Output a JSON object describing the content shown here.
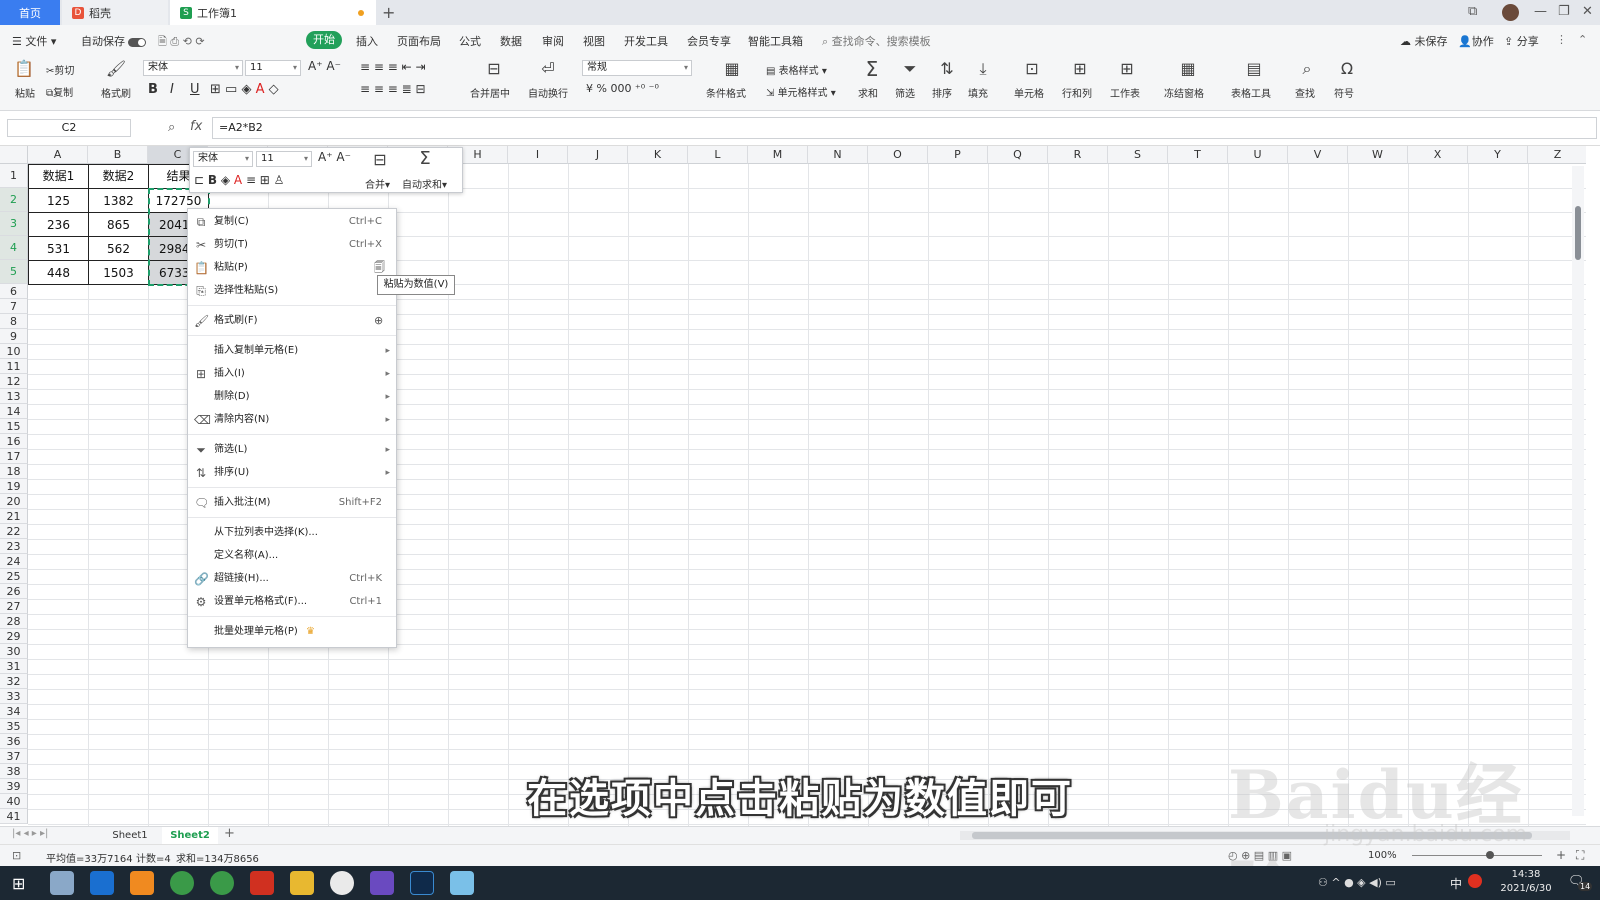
{
  "tabs": {
    "home": "首页",
    "daoke": "稻壳",
    "workbook": "工作簿1"
  },
  "menubar": {
    "file": "文件",
    "autosave": "自动保存",
    "items": [
      "开始",
      "插入",
      "页面布局",
      "公式",
      "数据",
      "审阅",
      "视图",
      "开发工具",
      "会员专享",
      "智能工具箱"
    ],
    "search": "查找命令、搜索模板",
    "unsaved": "未保存",
    "collab": "协作",
    "share": "分享"
  },
  "ribbon": {
    "paste": "粘贴",
    "cut": "剪切",
    "copy": "复制",
    "format_painter": "格式刷",
    "font_name": "宋体",
    "font_size": "11",
    "merge_center": "合并居中",
    "wrap": "自动换行",
    "number_format": "常规",
    "cond_format": "条件格式",
    "table_style": "表格样式",
    "cell_style": "单元格样式",
    "sum": "求和",
    "filter": "筛选",
    "sort": "排序",
    "fill": "填充",
    "cell": "单元格",
    "row_col": "行和列",
    "worksheet": "工作表",
    "freeze": "冻结窗格",
    "table_tools": "表格工具",
    "find": "查找",
    "symbol": "符号"
  },
  "formula_bar": {
    "name_box": "C2",
    "fx": "fx",
    "formula": "=A2*B2"
  },
  "columns": [
    "A",
    "B",
    "C",
    "D",
    "E",
    "F",
    "G",
    "H",
    "I",
    "J",
    "K",
    "L",
    "M",
    "N",
    "O",
    "P",
    "Q",
    "R",
    "S",
    "T",
    "U",
    "V",
    "W",
    "X",
    "Y",
    "Z"
  ],
  "rows": [
    "1",
    "2",
    "3",
    "4",
    "5",
    "6",
    "7",
    "8",
    "9",
    "10",
    "11",
    "12",
    "13",
    "14",
    "15",
    "16",
    "17",
    "18",
    "19",
    "20",
    "21",
    "22",
    "23",
    "24",
    "25",
    "26",
    "27",
    "28",
    "29",
    "30",
    "31",
    "32",
    "33",
    "34",
    "35",
    "36",
    "37",
    "38",
    "39",
    "40",
    "41"
  ],
  "table": {
    "headers": [
      "数据1",
      "数据2",
      "结果"
    ],
    "a": [
      "125",
      "236",
      "531",
      "448"
    ],
    "b": [
      "1382",
      "865",
      "562",
      "1503"
    ],
    "c": [
      "172750",
      "2041",
      "2984",
      "6733"
    ]
  },
  "mini_toolbar": {
    "font_name": "宋体",
    "font_size": "11",
    "merge": "合并",
    "autosum": "自动求和"
  },
  "context_menu": {
    "copy": "复制(C)",
    "copy_sc": "Ctrl+C",
    "cut": "剪切(T)",
    "cut_sc": "Ctrl+X",
    "paste": "粘贴(P)",
    "paste_special": "选择性粘贴(S)",
    "format_painter": "格式刷(F)",
    "insert_copied": "插入复制单元格(E)",
    "insert": "插入(I)",
    "delete": "删除(D)",
    "clear": "清除内容(N)",
    "filter": "筛选(L)",
    "sort": "排序(U)",
    "comment": "插入批注(M)",
    "comment_sc": "Shift+F2",
    "pick_list": "从下拉列表中选择(K)...",
    "define_name": "定义名称(A)...",
    "hyperlink": "超链接(H)...",
    "hyperlink_sc": "Ctrl+K",
    "format_cells": "设置单元格格式(F)...",
    "format_cells_sc": "Ctrl+1",
    "batch": "批量处理单元格(P)"
  },
  "tooltip": "粘贴为数值(V)",
  "sheets": [
    "Sheet1",
    "Sheet2"
  ],
  "status": {
    "avg": "平均值=33万7164",
    "count": "计数=4",
    "sum": "求和=134万8656",
    "zoom": "100%"
  },
  "taskbar": {
    "time": "14:38",
    "date": "2021/6/30",
    "ime": "中",
    "notif": "14"
  },
  "caption": "在选项中点击粘贴为数值即可",
  "watermark": {
    "brand": "Baidu经验",
    "url": "jingyan.baidu.com"
  },
  "colors": {
    "accent_blue": "#3a7df0",
    "start_green": "#22a05a",
    "sheet_green": "#1e9e50",
    "selection_dash": "#1e9e6a",
    "taskbar": "#1c2833"
  }
}
